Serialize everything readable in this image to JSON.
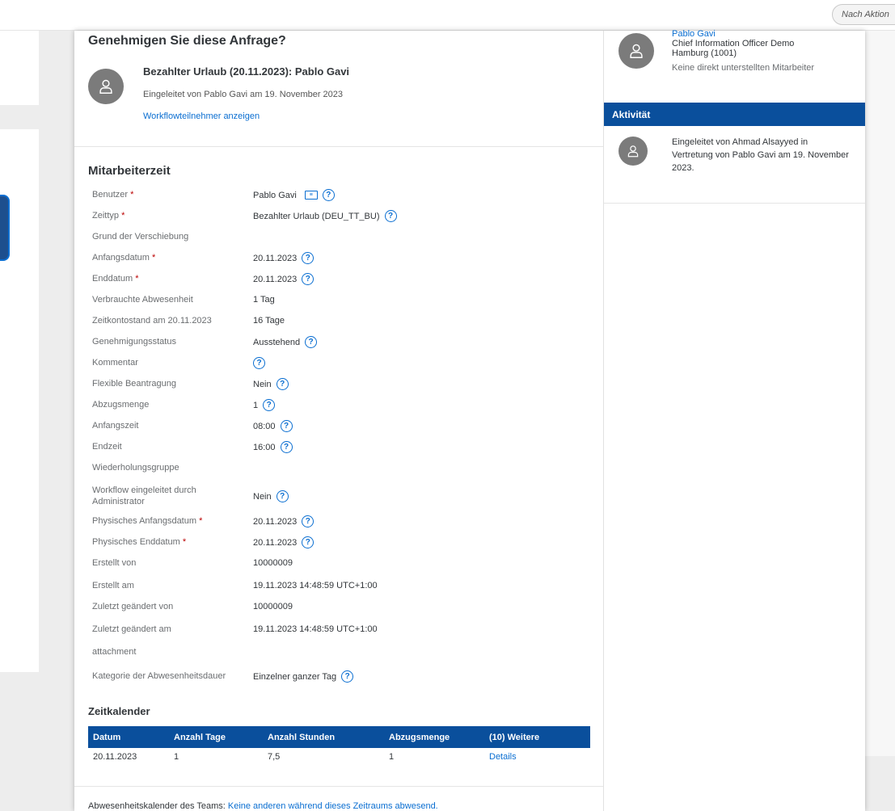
{
  "topbar": {
    "action_button_label": "Nach Aktion"
  },
  "request": {
    "title": "Genehmigen Sie diese Anfrage?",
    "subject": "Bezahlter Urlaub (20.11.2023): Pablo Gavi",
    "initiated": "Eingeleitet von Pablo Gavi am 19. November 2023",
    "participants_link": "Workflowteilnehmer anzeigen"
  },
  "employee_time": {
    "title": "Mitarbeiterzeit",
    "required_marker": "*",
    "help_glyph": "?",
    "rows": [
      {
        "label": "Benutzer",
        "required": true,
        "value": "Pablo Gavi",
        "card": true,
        "help": true
      },
      {
        "label": "Zeittyp",
        "required": true,
        "value": "Bezahlter Urlaub (DEU_TT_BU)",
        "help": true
      },
      {
        "label": "Grund der Verschiebung",
        "value": ""
      },
      {
        "label": "Anfangsdatum",
        "required": true,
        "value": "20.11.2023",
        "help": true
      },
      {
        "label": "Enddatum",
        "required": true,
        "value": "20.11.2023",
        "help": true
      },
      {
        "label": "Verbrauchte Abwesenheit",
        "value": "1 Tag"
      },
      {
        "label": "Zeitkontostand am 20.11.2023",
        "value": "16 Tage"
      },
      {
        "label": "Genehmigungsstatus",
        "value": "Ausstehend",
        "help": true
      },
      {
        "label": "Kommentar",
        "value": "",
        "help": true
      },
      {
        "label": "Flexible Beantragung",
        "value": "Nein",
        "help": true
      },
      {
        "label": "Abzugsmenge",
        "value": "1",
        "help": true
      },
      {
        "label": "Anfangszeit",
        "value": "08:00",
        "help": true
      },
      {
        "label": "Endzeit",
        "value": "16:00",
        "help": true
      },
      {
        "label": "Wiederholungsgruppe",
        "value": ""
      },
      {
        "label": "Workflow eingeleitet durch Administrator",
        "value": "Nein",
        "help": true
      },
      {
        "label": "Physisches Anfangsdatum",
        "required": true,
        "value": "20.11.2023",
        "help": true
      },
      {
        "label": "Physisches Enddatum",
        "required": true,
        "value": "20.11.2023",
        "help": true
      },
      {
        "label": "Erstellt von",
        "value": "10000009"
      },
      {
        "label": "Erstellt am",
        "value": "19.11.2023 14:48:59 UTC+1:00"
      },
      {
        "label": "Zuletzt geändert von",
        "value": "10000009"
      },
      {
        "label": "Zuletzt geändert am",
        "value": "19.11.2023 14:48:59 UTC+1:00"
      },
      {
        "label": "attachment",
        "value": ""
      },
      {
        "label": "Kategorie der Abwesenheitsdauer",
        "value": "Einzelner ganzer Tag",
        "help": true
      }
    ]
  },
  "calendar": {
    "title": "Zeitkalender",
    "columns": [
      "Datum",
      "Anzahl Tage",
      "Anzahl Stunden",
      "Abzugsmenge",
      "(10) Weitere"
    ],
    "rows": [
      [
        "20.11.2023",
        "1",
        "7,5",
        "1",
        "Details"
      ]
    ]
  },
  "footer": {
    "prefix": "Abwesenheitskalender des Teams:",
    "link": "Keine anderen während dieses Zeitraums abwesend."
  },
  "sidebar": {
    "name": "Pablo Gavi",
    "job_title": "Chief Information Officer Demo",
    "location": "Hamburg (1001)",
    "reports": "Keine direkt unterstellten Mitarbeiter",
    "activity_title": "Aktivität",
    "activity_text": "Eingeleitet von Ahmad Alsayyed in Vertretung von Pablo Gavi am 19. November 2023."
  }
}
